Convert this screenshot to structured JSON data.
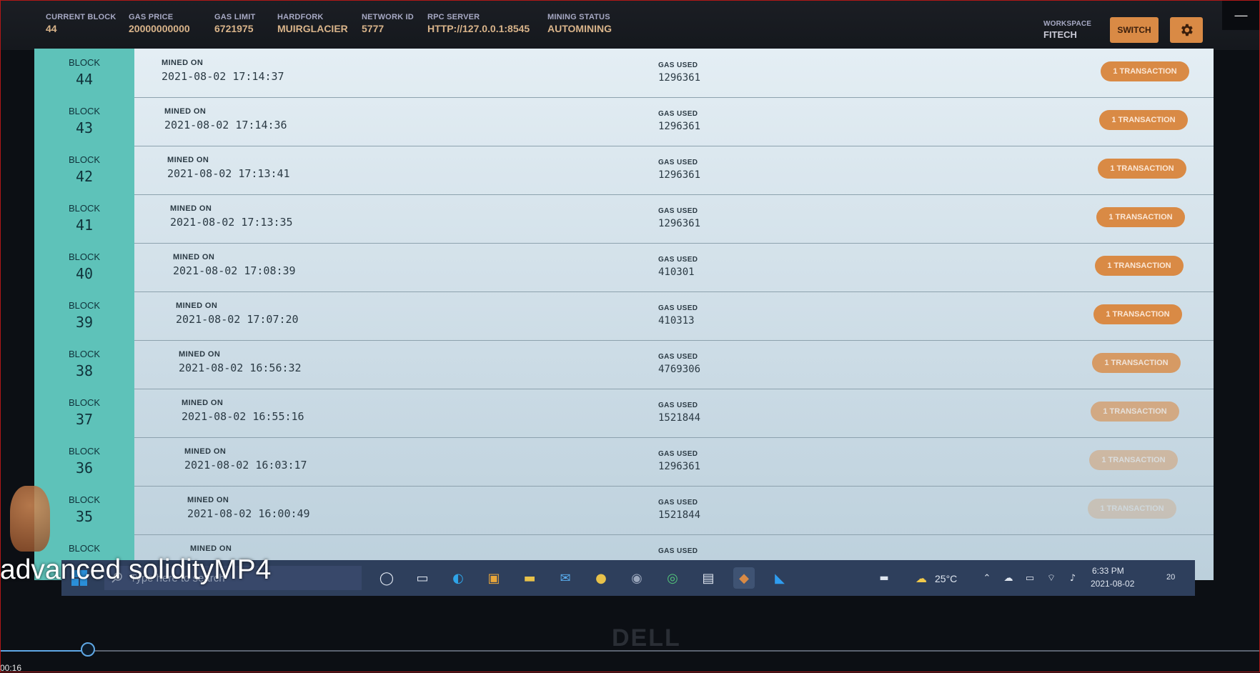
{
  "header": {
    "stats": [
      {
        "label": "CURRENT BLOCK",
        "value": "44"
      },
      {
        "label": "GAS PRICE",
        "value": "20000000000"
      },
      {
        "label": "GAS LIMIT",
        "value": "6721975"
      },
      {
        "label": "HARDFORK",
        "value": "MUIRGLACIER"
      },
      {
        "label": "NETWORK ID",
        "value": "5777"
      },
      {
        "label": "RPC SERVER",
        "value": "HTTP://127.0.0.1:8545"
      },
      {
        "label": "MINING STATUS",
        "value": "AUTOMINING"
      }
    ],
    "workspace_label": "WORKSPACE",
    "workspace_name": "FITECH",
    "switch_label": "SWITCH",
    "minimize_glyph": "—"
  },
  "blocks_labels": {
    "block": "BLOCK",
    "mined_on": "MINED ON",
    "gas_used": "GAS USED"
  },
  "blocks": [
    {
      "number": "44",
      "mined_on": "2021-08-02 17:14:37",
      "gas_used": "1296361",
      "tx": "1 TRANSACTION"
    },
    {
      "number": "43",
      "mined_on": "2021-08-02 17:14:36",
      "gas_used": "1296361",
      "tx": "1 TRANSACTION"
    },
    {
      "number": "42",
      "mined_on": "2021-08-02 17:13:41",
      "gas_used": "1296361",
      "tx": "1 TRANSACTION"
    },
    {
      "number": "41",
      "mined_on": "2021-08-02 17:13:35",
      "gas_used": "1296361",
      "tx": "1 TRANSACTION"
    },
    {
      "number": "40",
      "mined_on": "2021-08-02 17:08:39",
      "gas_used": "410301",
      "tx": "1 TRANSACTION"
    },
    {
      "number": "39",
      "mined_on": "2021-08-02 17:07:20",
      "gas_used": "410313",
      "tx": "1 TRANSACTION"
    },
    {
      "number": "38",
      "mined_on": "2021-08-02 16:56:32",
      "gas_used": "4769306",
      "tx": "1 TRANSACTION"
    },
    {
      "number": "37",
      "mined_on": "2021-08-02 16:55:16",
      "gas_used": "1521844",
      "tx": "1 TRANSACTION"
    },
    {
      "number": "36",
      "mined_on": "2021-08-02 16:03:17",
      "gas_used": "1296361",
      "tx": "1 TRANSACTION"
    },
    {
      "number": "35",
      "mined_on": "2021-08-02 16:00:49",
      "gas_used": "1521844",
      "tx": "1 TRANSACTION"
    },
    {
      "number": "",
      "mined_on": "",
      "gas_used": "",
      "tx": ""
    }
  ],
  "taskbar": {
    "search_placeholder": "Type here to search",
    "weather": "25°C",
    "time": "6:33 PM",
    "date": "2021-08-02",
    "notification_count": "20",
    "icons": [
      "cortana-icon",
      "task-view-icon",
      "edge-icon",
      "store-icon",
      "file-explorer-icon",
      "mail-icon",
      "chrome-icon",
      "app-icon",
      "app-icon",
      "photos-icon",
      "ganache-icon",
      "vscode-icon"
    ]
  },
  "video": {
    "title": "advanced solidityMP4",
    "timecode": "00:16",
    "progress": 0.07
  },
  "colors": {
    "accent": "#d98a45",
    "block_cell": "#5ec2b9",
    "header_label": "#a7a9c4",
    "header_value": "#d9b48a"
  }
}
